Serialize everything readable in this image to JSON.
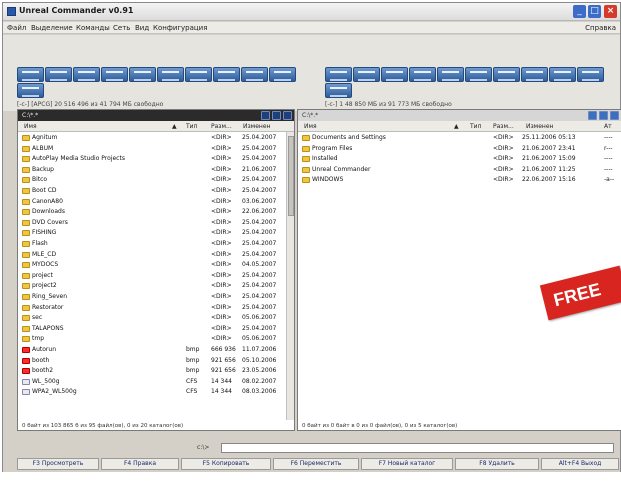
{
  "window": {
    "title": "Unreal Commander v0.91",
    "controls": {
      "minimize": "_",
      "maximize": "□",
      "close": "×"
    }
  },
  "menu": {
    "items": [
      "Файл",
      "Выделение",
      "Команды",
      "Сеть",
      "Вид",
      "Конфигурация"
    ],
    "right": "Справка"
  },
  "left_drive_info": "[-c-] [APCG] 20 516 496 из 41 794 МБ свободно",
  "right_drive_info": "[-c-] 1 48 850 МБ из 91 773 МБ свободно",
  "left_panel": {
    "path": "C:\\*.*",
    "columns": {
      "name": "Имя",
      "type": "Тип",
      "size": "Разм...",
      "date": "Изменен"
    },
    "rows": [
      {
        "name": "Agnitum",
        "type": "",
        "size": "<DIR>",
        "date": "25.04.2007",
        "icon": "folder"
      },
      {
        "name": "ALBUM",
        "type": "",
        "size": "<DIR>",
        "date": "25.04.2007",
        "icon": "folder"
      },
      {
        "name": "AutoPlay Media Studio Projects",
        "type": "",
        "size": "<DIR>",
        "date": "25.04.2007",
        "icon": "folder"
      },
      {
        "name": "Backup",
        "type": "",
        "size": "<DIR>",
        "date": "21.06.2007",
        "icon": "folder"
      },
      {
        "name": "Bitco",
        "type": "",
        "size": "<DIR>",
        "date": "25.04.2007",
        "icon": "folder"
      },
      {
        "name": "Boot CD",
        "type": "",
        "size": "<DIR>",
        "date": "25.04.2007",
        "icon": "folder"
      },
      {
        "name": "CanonA80",
        "type": "",
        "size": "<DIR>",
        "date": "03.06.2007",
        "icon": "folder"
      },
      {
        "name": "Downloads",
        "type": "",
        "size": "<DIR>",
        "date": "22.06.2007",
        "icon": "folder"
      },
      {
        "name": "DVD Covers",
        "type": "",
        "size": "<DIR>",
        "date": "25.04.2007",
        "icon": "folder"
      },
      {
        "name": "FISHING",
        "type": "",
        "size": "<DIR>",
        "date": "25.04.2007",
        "icon": "folder"
      },
      {
        "name": "Flash",
        "type": "",
        "size": "<DIR>",
        "date": "25.04.2007",
        "icon": "folder"
      },
      {
        "name": "MLE_CD",
        "type": "",
        "size": "<DIR>",
        "date": "25.04.2007",
        "icon": "folder"
      },
      {
        "name": "MYDOCS",
        "type": "",
        "size": "<DIR>",
        "date": "04.05.2007",
        "icon": "folder"
      },
      {
        "name": "project",
        "type": "",
        "size": "<DIR>",
        "date": "25.04.2007",
        "icon": "folder"
      },
      {
        "name": "project2",
        "type": "",
        "size": "<DIR>",
        "date": "25.04.2007",
        "icon": "folder"
      },
      {
        "name": "Ring_Seven",
        "type": "",
        "size": "<DIR>",
        "date": "25.04.2007",
        "icon": "folder"
      },
      {
        "name": "Restorator",
        "type": "",
        "size": "<DIR>",
        "date": "25.04.2007",
        "icon": "folder"
      },
      {
        "name": "sec",
        "type": "",
        "size": "<DIR>",
        "date": "05.06.2007",
        "icon": "folder"
      },
      {
        "name": "TALAPONS",
        "type": "",
        "size": "<DIR>",
        "date": "25.04.2007",
        "icon": "folder"
      },
      {
        "name": "tmp",
        "type": "",
        "size": "<DIR>",
        "date": "05.06.2007",
        "icon": "folder"
      },
      {
        "name": "Autorun",
        "type": "bmp",
        "size": "666 936",
        "date": "11.07.2006",
        "icon": "bmp"
      },
      {
        "name": "booth",
        "type": "bmp",
        "size": "921 656",
        "date": "05.10.2006",
        "icon": "bmp"
      },
      {
        "name": "booth2",
        "type": "bmp",
        "size": "921 656",
        "date": "23.05.2006",
        "icon": "bmp"
      },
      {
        "name": "WL_500g",
        "type": "CFS",
        "size": "14 344",
        "date": "08.02.2007",
        "icon": "file"
      },
      {
        "name": "WPA2_WL500g",
        "type": "CFS",
        "size": "14 344",
        "date": "08.03.2006",
        "icon": "file"
      }
    ],
    "status": "0 байт из 103 865 б из 95 файл(ов), 0 из 20 каталог(ов)"
  },
  "right_panel": {
    "path": "C:\\*.*",
    "columns": {
      "name": "Имя",
      "type": "Тип",
      "size": "Разм...",
      "date": "Изменен",
      "attr": "Ат"
    },
    "rows": [
      {
        "name": "Documents and Settings",
        "size": "<DIR>",
        "date": "25.11.2006 05:13",
        "attr": "----"
      },
      {
        "name": "Program Files",
        "size": "<DIR>",
        "date": "21.06.2007 23:41",
        "attr": "r---"
      },
      {
        "name": "Installed",
        "size": "<DIR>",
        "date": "21.06.2007 15:09",
        "attr": "----"
      },
      {
        "name": "Unreal Commander",
        "size": "<DIR>",
        "date": "21.06.2007 11:25",
        "attr": "----"
      },
      {
        "name": "WINDOWS",
        "size": "<DIR>",
        "date": "22.06.2007 15:16",
        "attr": "-a--"
      }
    ],
    "status": "0 байт из 0 байт в 0 из 0 файл(ов), 0 из 5 каталог(ов)"
  },
  "command_line": {
    "label": "c:\\>"
  },
  "fkeys": [
    "F3 Просмотреть",
    "F4 Правка",
    "F5 Копировать",
    "F6 Переместить",
    "F7 Новый каталог",
    "F8 Удалить",
    "Alt+F4 Выход"
  ],
  "banner": {
    "text": "FREE",
    "color": "#d8251f"
  }
}
